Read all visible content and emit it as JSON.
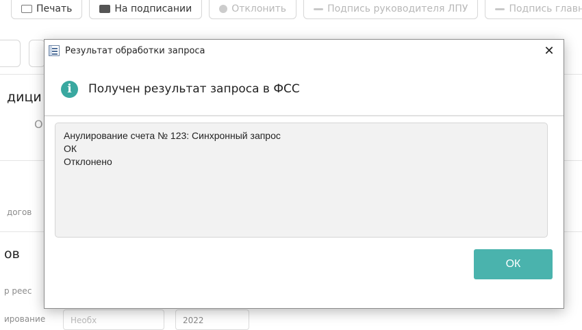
{
  "background": {
    "toolbar": {
      "print": "Печать",
      "on_signing": "На подписании",
      "reject": "Отклонить",
      "head_signature": "Подпись руководителя ЛПУ",
      "chief_signature": "Подпись главн"
    },
    "fragments": {
      "section_heading": "дици",
      "column_fragment": "О",
      "contract_label": "догов",
      "section_heading_2": "ов",
      "registry_label": "р реес",
      "period_label": "ирование",
      "input_placeholder": "Необх",
      "year_value": "2022"
    }
  },
  "dialog": {
    "title": "Результат обработки запроса",
    "close_glyph": "✕",
    "info_glyph": "i",
    "header": "Получен результат запроса в ФСС",
    "message_lines": [
      "Анулирование счета № 123: Синхронный запрос",
      "ОК",
      "Отклонено"
    ],
    "ok_label": "ОК",
    "accent_color": "#4ab3ad"
  }
}
